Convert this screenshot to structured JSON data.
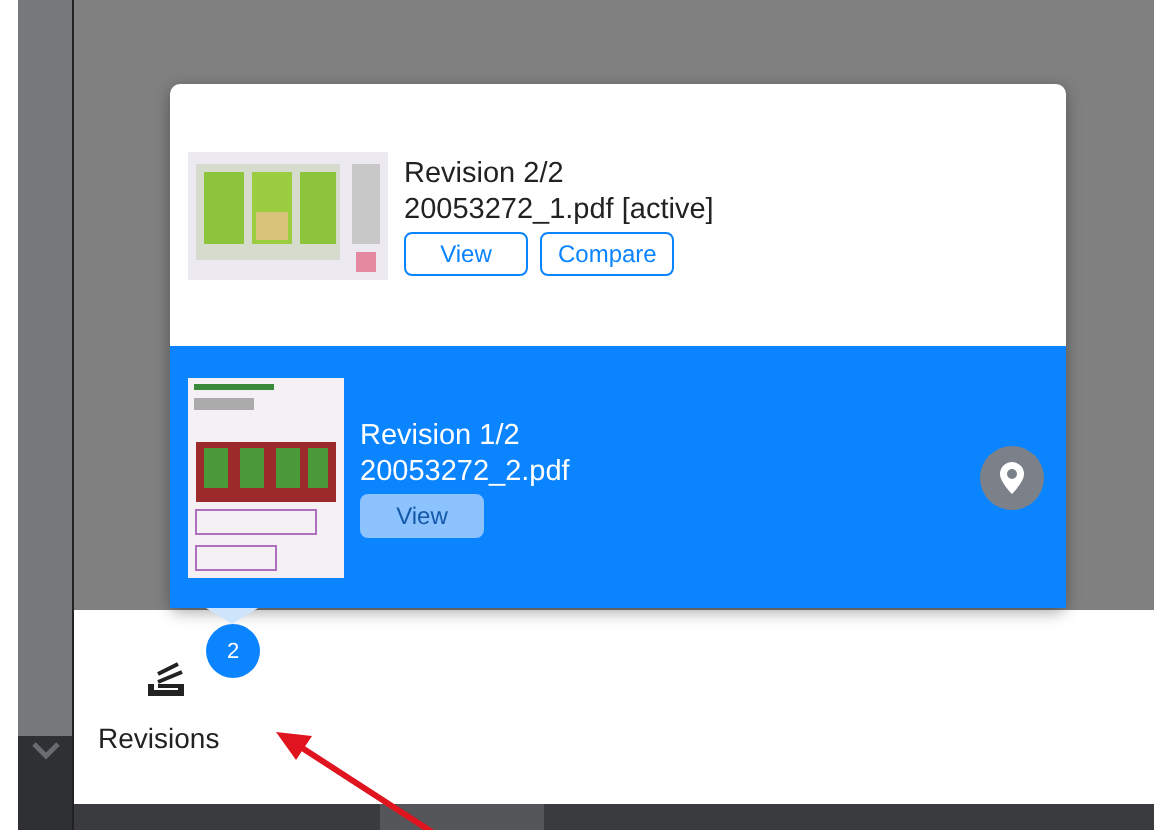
{
  "revisions": [
    {
      "title": "Revision 2/2",
      "file": "20053272_1.pdf [active]",
      "selected": false,
      "pinned": false,
      "buttons": [
        "View",
        "Compare"
      ]
    },
    {
      "title": "Revision 1/2",
      "file": "20053272_2.pdf",
      "selected": true,
      "pinned": true,
      "buttons": [
        "View"
      ]
    }
  ],
  "toolbar": {
    "badge": "2",
    "label": "Revisions"
  }
}
